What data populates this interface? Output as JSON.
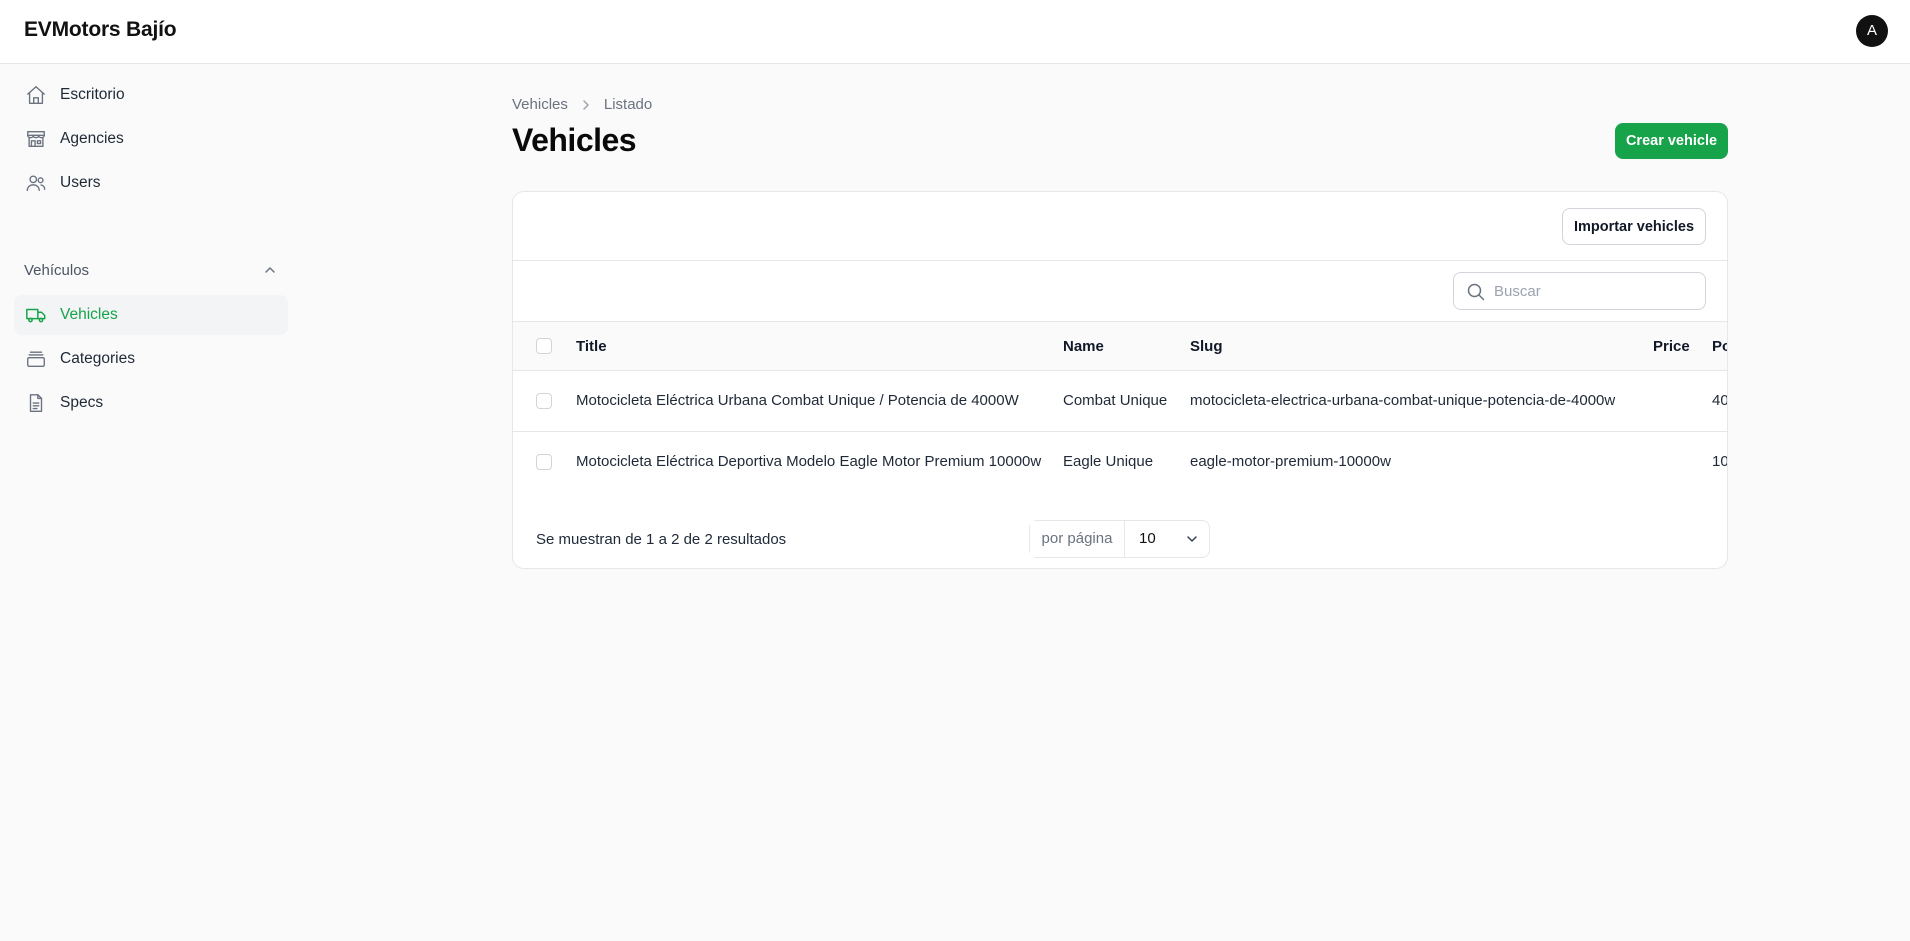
{
  "app": {
    "brand": "EVMotors Bajío",
    "avatar_initial": "A"
  },
  "colors": {
    "accent": "#16a34a",
    "text": "#111827",
    "muted": "#6b7280",
    "border": "#e5e7eb"
  },
  "sidebar": {
    "items": [
      {
        "label": "Escritorio",
        "icon": "house-icon"
      },
      {
        "label": "Agencies",
        "icon": "storefront-icon"
      },
      {
        "label": "Users",
        "icon": "users-icon"
      }
    ],
    "group": {
      "label": "Vehículos",
      "expanded": true,
      "items": [
        {
          "label": "Vehicles",
          "icon": "truck-icon",
          "active": true
        },
        {
          "label": "Categories",
          "icon": "stack-icon",
          "active": false
        },
        {
          "label": "Specs",
          "icon": "document-icon",
          "active": false
        }
      ]
    }
  },
  "breadcrumb": {
    "parent": "Vehicles",
    "current": "Listado"
  },
  "page": {
    "title": "Vehicles",
    "create_button": "Crear vehicle"
  },
  "table": {
    "import_button": "Importar vehicles",
    "search_placeholder": "Buscar",
    "columns": [
      "Title",
      "Name",
      "Slug",
      "Price",
      "Po"
    ],
    "rows": [
      {
        "title": "Motocicleta Eléctrica Urbana Combat Unique / Potencia de 4000W",
        "name": "Combat Unique",
        "slug": "motocicleta-electrica-urbana-combat-unique-potencia-de-4000w",
        "price": "",
        "po": "40"
      },
      {
        "title": "Motocicleta Eléctrica Deportiva Modelo Eagle Motor Premium 10000w",
        "name": "Eagle Unique",
        "slug": "eagle-motor-premium-10000w",
        "price": "",
        "po": "10"
      }
    ],
    "results_text": "Se muestran de 1 a 2 de 2 resultados",
    "per_page_label": "por página",
    "per_page_value": "10"
  }
}
